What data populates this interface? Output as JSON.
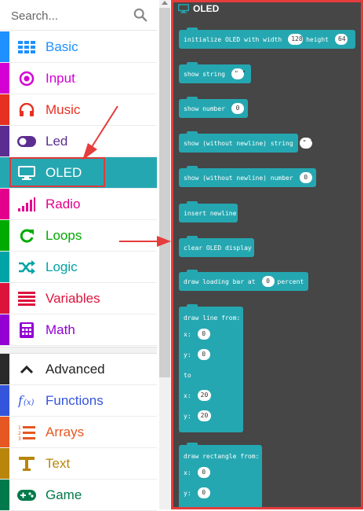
{
  "search": {
    "placeholder": "Search..."
  },
  "categories": [
    {
      "label": "Basic",
      "color": "#1e90ff",
      "icon": "grid-icon"
    },
    {
      "label": "Input",
      "color": "#d400d4",
      "icon": "target-icon"
    },
    {
      "label": "Music",
      "color": "#e63022",
      "icon": "headphones-icon"
    },
    {
      "label": "Led",
      "color": "#5c2d91",
      "icon": "toggle-icon"
    },
    {
      "label": "OLED",
      "color": "#25a7b1",
      "icon": "monitor-icon",
      "selected": true
    },
    {
      "label": "Radio",
      "color": "#e3008c",
      "icon": "signal-bars-icon"
    },
    {
      "label": "Loops",
      "color": "#00aa00",
      "icon": "refresh-icon"
    },
    {
      "label": "Logic",
      "color": "#00a4a6",
      "icon": "shuffle-icon"
    },
    {
      "label": "Variables",
      "color": "#dc143c",
      "icon": "list-lines-icon"
    },
    {
      "label": "Math",
      "color": "#9400d3",
      "icon": "calculator-icon"
    },
    {
      "label": "Advanced",
      "color": "#2a2a2a",
      "icon": "chevron-up-icon"
    },
    {
      "label": "Functions",
      "color": "#3455db",
      "icon": "function-icon"
    },
    {
      "label": "Arrays",
      "color": "#e65722",
      "icon": "numbered-list-icon"
    },
    {
      "label": "Text",
      "color": "#b8860b",
      "icon": "text-icon"
    },
    {
      "label": "Game",
      "color": "#007a4b",
      "icon": "gamepad-icon"
    }
  ],
  "flyout": {
    "title": "OLED",
    "blocks": {
      "init": {
        "text": "initialize OLED with width",
        "width": "128",
        "height_label": "height",
        "height": "64"
      },
      "show_string": {
        "text": "show string",
        "value": "\" \""
      },
      "show_number": {
        "text": "show number",
        "value": "0"
      },
      "show_string_nonl": {
        "text": "show (without newline) string",
        "value": "\" \""
      },
      "show_number_nonl": {
        "text": "show (without newline) number",
        "value": "0"
      },
      "insert_newline": {
        "text": "insert newline"
      },
      "clear": {
        "text": "clear OLED display"
      },
      "loading_bar": {
        "text": "draw loading bar at",
        "value": "0",
        "suffix": "percent"
      },
      "draw_line": {
        "text": "draw line from:",
        "x_label": "x:",
        "x0": "0",
        "y_label": "y:",
        "y0": "0",
        "to": "to",
        "x1": "20",
        "y1": "20"
      },
      "draw_rect": {
        "text": "draw rectangle from:",
        "x_label": "x:",
        "x0": "0",
        "y_label": "y:",
        "y0": "0"
      }
    }
  }
}
